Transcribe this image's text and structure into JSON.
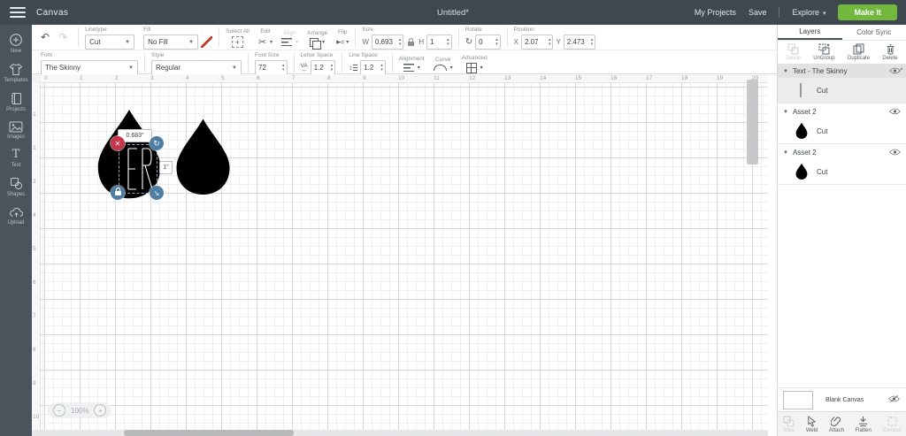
{
  "header": {
    "app_title": "Canvas",
    "doc_title": "Untitled*",
    "my_projects": "My Projects",
    "save": "Save",
    "explore": "Explore",
    "make_it": "Make It"
  },
  "sidebar": {
    "items": [
      {
        "label": "New"
      },
      {
        "label": "Templates"
      },
      {
        "label": "Projects"
      },
      {
        "label": "Images"
      },
      {
        "label": "Text"
      },
      {
        "label": "Shapes"
      },
      {
        "label": "Upload"
      }
    ]
  },
  "toolbar": {
    "linetype_label": "Linetype",
    "linetype_value": "Cut",
    "fill_label": "Fill",
    "fill_value": "No Fill",
    "select_all_label": "Select All",
    "edit_label": "Edit",
    "align_label": "Align",
    "arrange_label": "Arrange",
    "flip_label": "Flip",
    "size_label": "Size",
    "w_label": "W",
    "w_value": "0.693",
    "h_label": "H",
    "h_value": "1",
    "rotate_label": "Rotate",
    "rotate_value": "0",
    "position_label": "Position",
    "x_label": "X",
    "x_value": "2.07",
    "y_label": "Y",
    "y_value": "2.473",
    "font_label": "Font",
    "font_value": "The Skinny",
    "style_label": "Style",
    "style_value": "Regular",
    "font_size_label": "Font Size",
    "font_size_value": "72",
    "letter_space_label": "Letter Space",
    "letter_space_value": "1.2",
    "line_space_label": "Line Space",
    "line_space_value": "1.2",
    "alignment_label": "Alignment",
    "curve_label": "Curve",
    "advanced_label": "Advanced"
  },
  "canvas": {
    "ruler_h": [
      0,
      1,
      2,
      3,
      4,
      5,
      6,
      7,
      8,
      9,
      10,
      11,
      12,
      13,
      14,
      15,
      16,
      17,
      18,
      19,
      20
    ],
    "ruler_v": [
      1,
      2,
      3,
      4,
      5,
      6,
      7,
      8,
      9,
      10
    ],
    "width_tooltip": "0.683\"",
    "height_tooltip": "1\"",
    "zoom_out": "−",
    "zoom_level": "100%",
    "zoom_in": "+"
  },
  "layers_panel": {
    "tabs": [
      {
        "label": "Layers"
      },
      {
        "label": "Color Sync"
      }
    ],
    "actions": [
      {
        "label": "Group",
        "enabled": false
      },
      {
        "label": "UnGroup",
        "enabled": true
      },
      {
        "label": "Duplicate",
        "enabled": true
      },
      {
        "label": "Delete",
        "enabled": true
      }
    ],
    "groups": [
      {
        "title": "Text - The Skinny",
        "sub": "Cut"
      },
      {
        "title": "Asset 2",
        "sub": "Cut"
      },
      {
        "title": "Asset 2",
        "sub": "Cut"
      }
    ],
    "blank_canvas_label": "Blank Canvas",
    "bottom_actions": [
      {
        "label": "Slice",
        "enabled": false
      },
      {
        "label": "Weld",
        "enabled": true
      },
      {
        "label": "Attach",
        "enabled": true
      },
      {
        "label": "Flatten",
        "enabled": true
      },
      {
        "label": "Contour",
        "enabled": false
      }
    ]
  },
  "icons": {
    "hamburger-icon": "three-bars",
    "undo-icon": "↶",
    "redo-icon": "↷",
    "rotate-icon": "↻",
    "scissors-icon": "✂",
    "flip-icon": "▸◃",
    "resize-icon": "↘",
    "delete-handle-icon": "✕",
    "caret-down": "▾",
    "stepper-up": "▴",
    "stepper-down": "▾"
  },
  "colors": {
    "header_bg": "#3f474f",
    "sidebar_bg": "#4b545c",
    "accent_green": "#71b83d",
    "handle_blue": "#4f7ea3",
    "handle_red": "#c8354b",
    "pen_red": "#c0392b"
  }
}
